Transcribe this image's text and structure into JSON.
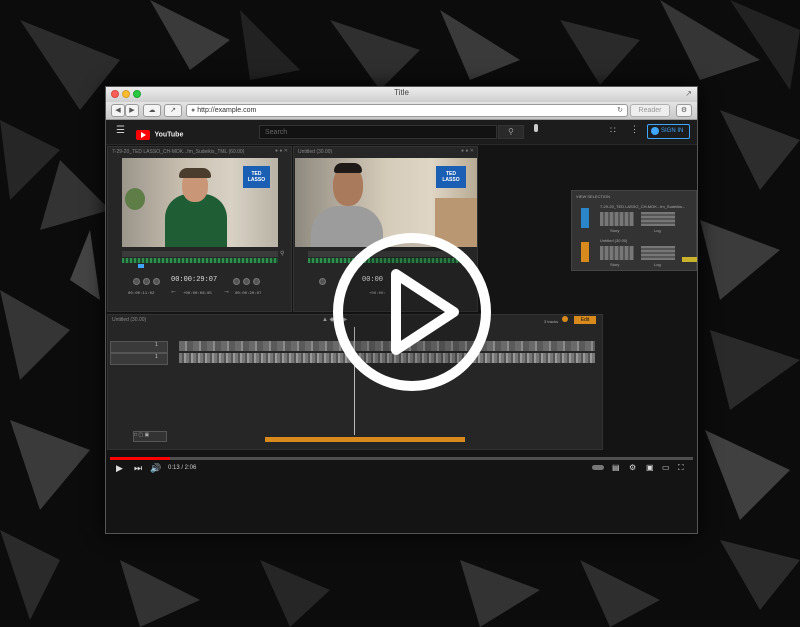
{
  "browser": {
    "title": "Title",
    "url": "http://example.com",
    "reader_label": "Reader"
  },
  "youtube": {
    "logo_text": "YouTube",
    "search_placeholder": "Search",
    "signin_label": "SIGN IN"
  },
  "source_viewer": {
    "title": "7-29-20_TED LASSO_CH-MOK...fm_Sudeikis_TML (60.00)",
    "timecode": "00:00:29:07",
    "in_tc": "00:00:11:02",
    "duration_tc": "+00:00:08:05",
    "out_tc": "00:00:20:07"
  },
  "record_viewer": {
    "title": "Untitled (30.00)",
    "timecode": "00:00",
    "offset_tc": "+00:00:"
  },
  "show_logo": {
    "line1": "TED",
    "line2": "LASSO"
  },
  "timeline": {
    "title": "Untitled (30.00)",
    "tracks_label": "3 tracks",
    "edit_label": "Edit",
    "track1": "1",
    "track2": "1"
  },
  "selection_panel": {
    "title": "VIEW SELECTION",
    "item1_name": "7-29-20_TED LASSO_CH-MOK...fm_Sudeikis...",
    "item1_label1": "Story",
    "item1_label2": "Log",
    "item2_name": "Untitled (30.00)",
    "item2_label1": "Story",
    "item2_label2": "Log"
  },
  "player": {
    "time_display": "0:13 / 2:06",
    "progress_fraction": 0.103
  },
  "colors": {
    "youtube_red": "#ff0000",
    "accent_orange": "#d98a1c",
    "signin_blue": "#3ea6ff",
    "audio_green": "#2f8f4e"
  }
}
